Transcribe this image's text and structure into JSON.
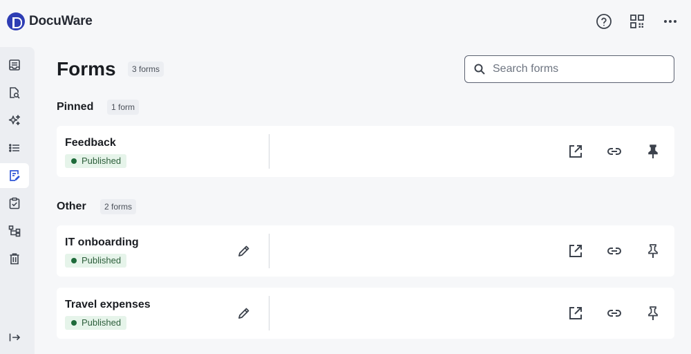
{
  "app": {
    "name": "DocuWare"
  },
  "header": {
    "icons": [
      "help-icon",
      "qr-code-icon",
      "more-icon"
    ]
  },
  "rail": {
    "items": [
      {
        "icon": "document-tray-icon",
        "active": false
      },
      {
        "icon": "document-search-icon",
        "active": false
      },
      {
        "icon": "sparkle-icon",
        "active": false
      },
      {
        "icon": "list-icon",
        "active": false
      },
      {
        "icon": "form-edit-icon",
        "active": true
      },
      {
        "icon": "clipboard-check-icon",
        "active": false
      },
      {
        "icon": "workflow-icon",
        "active": false
      },
      {
        "icon": "trash-icon",
        "active": false
      }
    ],
    "collapse_icon": "expand-rail-icon"
  },
  "page": {
    "title": "Forms",
    "count": "3 forms",
    "search_placeholder": "Search forms"
  },
  "sections": {
    "pinned": {
      "title": "Pinned",
      "count": "1 form",
      "forms": [
        {
          "name": "Feedback",
          "status": "Published"
        }
      ]
    },
    "other": {
      "title": "Other",
      "count": "2 forms",
      "forms": [
        {
          "name": "IT onboarding",
          "status": "Published"
        },
        {
          "name": "Travel expenses",
          "status": "Published"
        }
      ]
    }
  },
  "colors": {
    "brand": "#2e3db4",
    "active_icon": "#2e55d6",
    "published_bg": "#e6f4ea",
    "published_dot": "#1e6b3a"
  }
}
